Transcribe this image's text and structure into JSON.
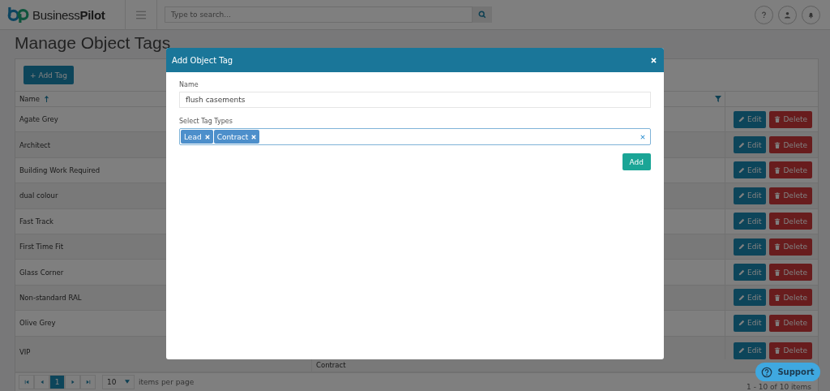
{
  "header": {
    "logo": "Business**Pilot**",
    "search": {
      "placeholder": "Type to search..."
    }
  },
  "page_title": "Manage Object Tags",
  "add_tag_button": "+ Add Tag",
  "table": {
    "columns": [
      {
        "label": "Name",
        "sorted": true
      },
      {
        "filter": true
      }
    ],
    "rows": [
      {
        "name": "Agate Grey",
        "edit": "Edit",
        "delete": "Delete"
      },
      {
        "name": "Architect",
        "edit": "Edit",
        "delete": "Delete"
      },
      {
        "name": "Building Work Required",
        "edit": "Edit",
        "delete": "Delete"
      },
      {
        "name": "dual colour",
        "edit": "Edit",
        "delete": "Delete"
      },
      {
        "name": "Fast Track",
        "edit": "Edit",
        "delete": "Delete"
      },
      {
        "name": "First Time Fit",
        "edit": "Edit",
        "delete": "Delete"
      },
      {
        "name": "Glass Corner",
        "edit": "Edit",
        "delete": "Delete"
      },
      {
        "name": "Non-standard RAL",
        "edit": "Edit",
        "delete": "Delete"
      },
      {
        "name": "Olive Grey",
        "edit": "Edit",
        "delete": "Delete"
      },
      {
        "name": "VIP",
        "column_2": "Contract",
        "edit": "Edit",
        "delete": "Delete"
      }
    ]
  },
  "pager": {
    "pages": [
      {
        "label": "1",
        "selected": true
      }
    ],
    "page_size": "10",
    "page_size_label": "items per page",
    "summary": "1 - 10 of 10 items"
  },
  "modal": {
    "title": "Add Object Tag",
    "name_label": "Name",
    "name_value": "flush casements",
    "types_label": "Select Tag Types",
    "tags": [
      "Lead",
      "Contract"
    ],
    "add_button": "Add"
  },
  "support_button": "Support"
}
